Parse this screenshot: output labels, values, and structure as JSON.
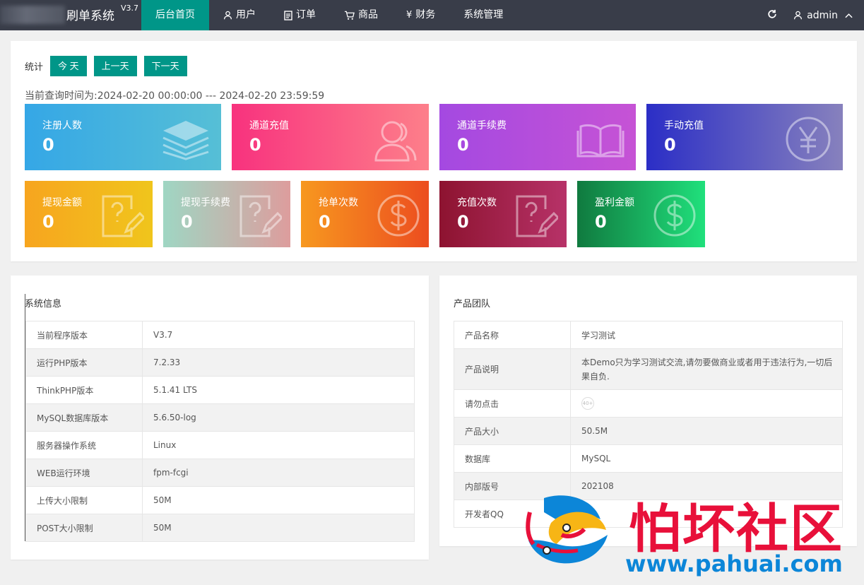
{
  "app": {
    "title": "刷单系统",
    "version": "V3.7"
  },
  "nav": [
    {
      "label": "后台首页",
      "icon": ""
    },
    {
      "label": "用户",
      "icon": "user-icon"
    },
    {
      "label": "订单",
      "icon": "document-icon"
    },
    {
      "label": "商品",
      "icon": "cart-icon"
    },
    {
      "label": "财务",
      "icon": "yen-icon"
    },
    {
      "label": "系统管理",
      "icon": ""
    }
  ],
  "user": {
    "name": "admin"
  },
  "stats": {
    "label": "统计",
    "buttons": [
      "今 天",
      "上一天",
      "下一天"
    ],
    "query_time": "当前查询时间为:2024-02-20 00:00:00 --- 2024-02-20 23:59:59",
    "cards": [
      {
        "title": "注册人数",
        "value": "0",
        "icon": "layers-icon"
      },
      {
        "title": "通道充值",
        "value": "0",
        "icon": "users-icon"
      },
      {
        "title": "通道手续费",
        "value": "0",
        "icon": "book-icon"
      },
      {
        "title": "手动充值",
        "value": "0",
        "icon": "yen-circle-icon"
      },
      {
        "title": "提现金额",
        "value": "0",
        "icon": "question-edit-icon"
      },
      {
        "title": "提现手续费",
        "value": "0",
        "icon": "question-edit-icon"
      },
      {
        "title": "抢单次数",
        "value": "0",
        "icon": "dollar-circle-icon"
      },
      {
        "title": "充值次数",
        "value": "0",
        "icon": "question-edit-icon"
      },
      {
        "title": "盈利金额",
        "value": "0",
        "icon": "dollar-circle-icon"
      }
    ]
  },
  "system_info": {
    "title": "系统信息",
    "rows": [
      {
        "k": "当前程序版本",
        "v": "V3.7"
      },
      {
        "k": "运行PHP版本",
        "v": "7.2.33"
      },
      {
        "k": "ThinkPHP版本",
        "v": "5.1.41 LTS"
      },
      {
        "k": "MySQL数据库版本",
        "v": "5.6.50-log"
      },
      {
        "k": "服务器操作系统",
        "v": "Linux"
      },
      {
        "k": "WEB运行环境",
        "v": "fpm-fcgi"
      },
      {
        "k": "上传大小限制",
        "v": "50M"
      },
      {
        "k": "POST大小限制",
        "v": "50M"
      }
    ]
  },
  "product_team": {
    "title": "产品团队",
    "rows": [
      {
        "k": "产品名称",
        "v": "学习测试"
      },
      {
        "k": "产品说明",
        "v": "本Demo只为学习测试交流,请勿要做商业或者用于违法行为,一切后果自负."
      },
      {
        "k": "请勿点击",
        "v": "40+"
      },
      {
        "k": "产品大小",
        "v": "50.5M"
      },
      {
        "k": "数据库",
        "v": "MySQL"
      },
      {
        "k": "内部版号",
        "v": "202108"
      },
      {
        "k": "开发者QQ",
        "v": ""
      }
    ]
  },
  "watermark": {
    "text": "怕坏社区",
    "url": "www.pahuai.com"
  }
}
